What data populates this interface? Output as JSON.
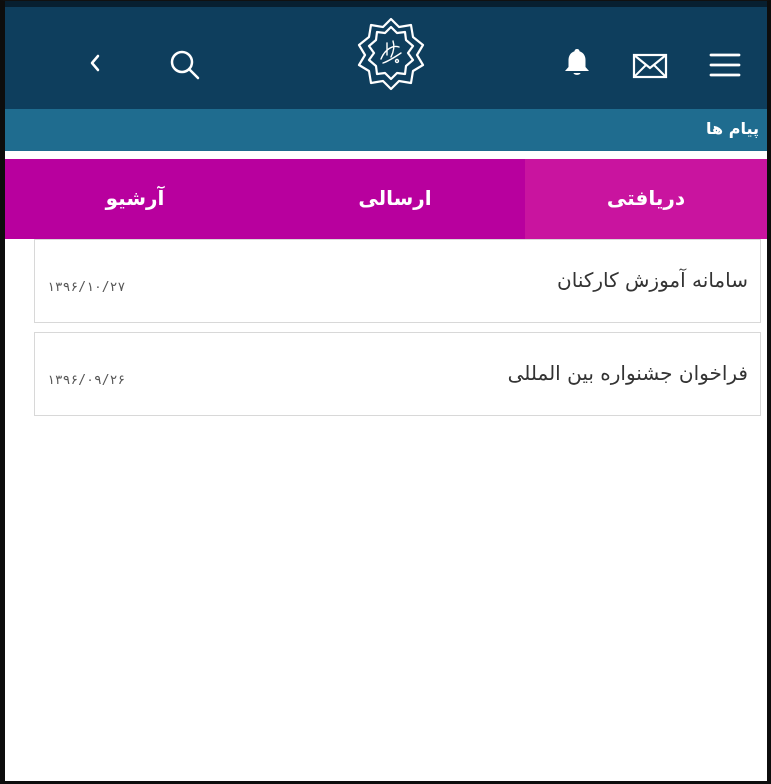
{
  "colors": {
    "header_bg": "#0e3e5d",
    "subheader_bg": "#1f6c8f",
    "tabs_bg": "#b8009e",
    "active_tab_bg": "#c9149f"
  },
  "header": {
    "icons": [
      "chevron-left-icon",
      "search-icon",
      "emblem-logo",
      "bell-icon",
      "envelope-icon",
      "hamburger-menu-icon"
    ]
  },
  "subheader": {
    "title": "پیام ها"
  },
  "tabs": [
    {
      "label": "دریافتی",
      "active": true
    },
    {
      "label": "ارسالی",
      "active": false
    },
    {
      "label": "آرشیو",
      "active": false
    }
  ],
  "messages": [
    {
      "subject": "سامانه آموزش کارکنان",
      "date": "۱۳۹۶/۱۰/۲۷"
    },
    {
      "subject": "فراخوان جشنواره بین المللی",
      "date": "۱۳۹۶/۰۹/۲۶"
    }
  ]
}
